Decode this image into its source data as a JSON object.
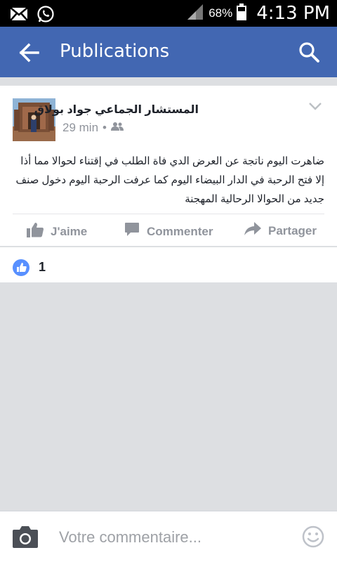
{
  "status_bar": {
    "battery_percent": "68%",
    "time": "4:13 PM",
    "icons": [
      "mail-icon",
      "whatsapp-icon",
      "signal-icon",
      "battery-icon"
    ]
  },
  "app_bar": {
    "title": "Publications",
    "back_icon": "arrow-left-icon",
    "search_icon": "search-icon"
  },
  "post": {
    "author": "المستشار الجماعي جواد بولاق",
    "time_ago": "29 min",
    "separator": "•",
    "audience_icon": "friends-icon",
    "text": "ضاهرت اليوم ناتجة عن العرض الدي فاة الطلب في إقتناء لحوالا مما أذا إلا فتح  الرحبة في الدار البيضاء اليوم كما عرفت الرحبة اليوم دخول صنف جديد من الحوالا الرحالية المهجنة",
    "actions": {
      "like": "J'aime",
      "comment": "Commenter",
      "share": "Partager"
    }
  },
  "reactions": {
    "count": "1",
    "badge_color": "#5890ff"
  },
  "comment_bar": {
    "placeholder": "Votre commentaire..."
  },
  "colors": {
    "brand": "#4267b2",
    "muted_text": "#90949c",
    "background": "#dddfe2"
  }
}
